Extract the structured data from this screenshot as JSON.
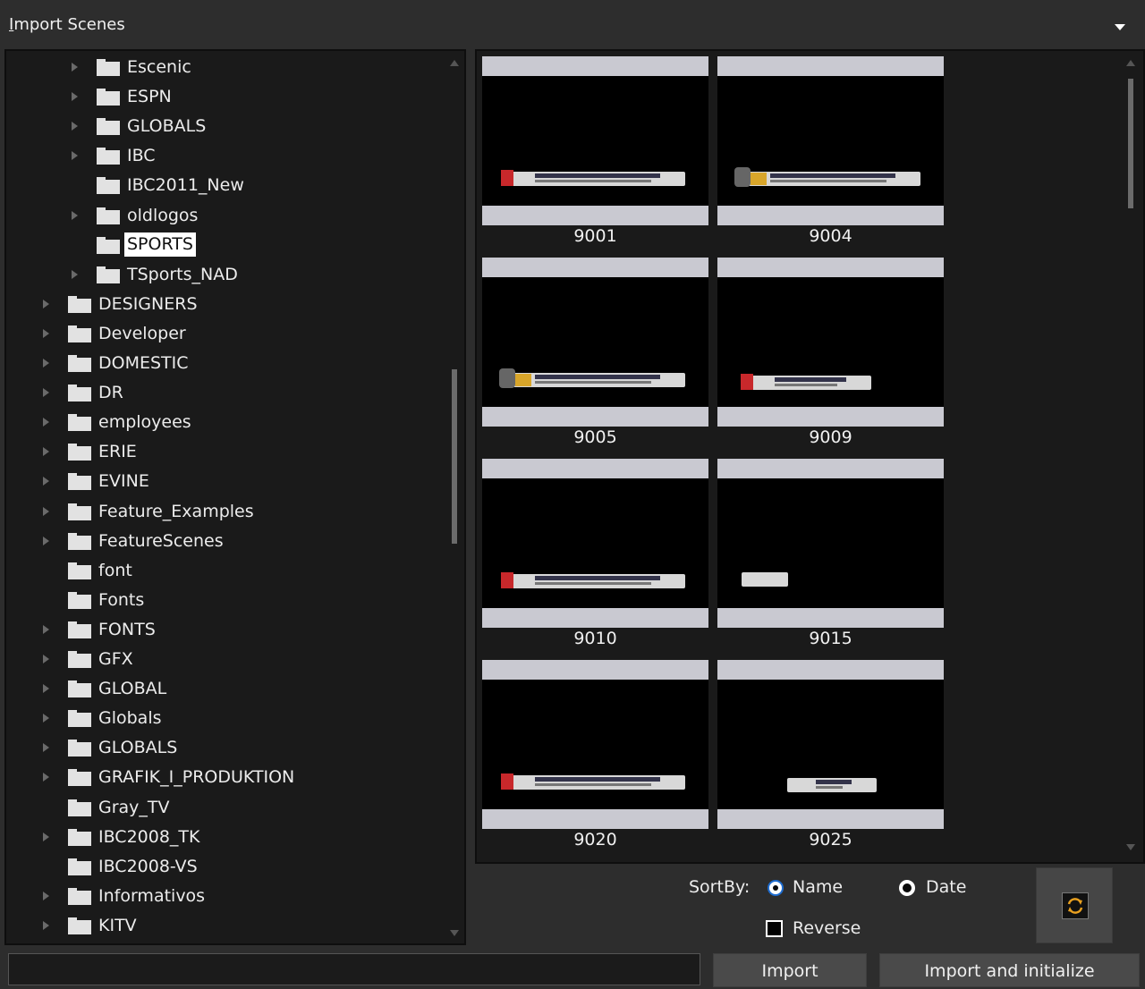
{
  "window": {
    "title": "Import Scenes",
    "title_mnemonic": "I",
    "title_rest": "mport Scenes"
  },
  "tree": {
    "items": [
      {
        "label": "Escenic",
        "level": 2,
        "expandable": true
      },
      {
        "label": "ESPN",
        "level": 2,
        "expandable": true
      },
      {
        "label": "GLOBALS",
        "level": 2,
        "expandable": true
      },
      {
        "label": "IBC",
        "level": 2,
        "expandable": true
      },
      {
        "label": "IBC2011_New",
        "level": 2,
        "expandable": false
      },
      {
        "label": "oldlogos",
        "level": 2,
        "expandable": true
      },
      {
        "label": "SPORTS",
        "level": 2,
        "expandable": false,
        "selected": true
      },
      {
        "label": "TSports_NAD",
        "level": 2,
        "expandable": true
      },
      {
        "label": "DESIGNERS",
        "level": 1,
        "expandable": true
      },
      {
        "label": "Developer",
        "level": 1,
        "expandable": true
      },
      {
        "label": "DOMESTIC",
        "level": 1,
        "expandable": true
      },
      {
        "label": "DR",
        "level": 1,
        "expandable": true
      },
      {
        "label": "employees",
        "level": 1,
        "expandable": true
      },
      {
        "label": "ERIE",
        "level": 1,
        "expandable": true
      },
      {
        "label": "EVINE",
        "level": 1,
        "expandable": true
      },
      {
        "label": "Feature_Examples",
        "level": 1,
        "expandable": true
      },
      {
        "label": "FeatureScenes",
        "level": 1,
        "expandable": true
      },
      {
        "label": "font",
        "level": 1,
        "expandable": false
      },
      {
        "label": "Fonts",
        "level": 1,
        "expandable": false
      },
      {
        "label": "FONTS",
        "level": 1,
        "expandable": true
      },
      {
        "label": "GFX",
        "level": 1,
        "expandable": true
      },
      {
        "label": "GLOBAL",
        "level": 1,
        "expandable": true
      },
      {
        "label": "Globals",
        "level": 1,
        "expandable": true
      },
      {
        "label": "GLOBALS",
        "level": 1,
        "expandable": true
      },
      {
        "label": "GRAFIK_I_PRODUKTION",
        "level": 1,
        "expandable": true
      },
      {
        "label": "Gray_TV",
        "level": 1,
        "expandable": false
      },
      {
        "label": "IBC2008_TK",
        "level": 1,
        "expandable": true
      },
      {
        "label": "IBC2008-VS",
        "level": 1,
        "expandable": false
      },
      {
        "label": "Informativos",
        "level": 1,
        "expandable": true
      },
      {
        "label": "KITV",
        "level": 1,
        "expandable": true
      }
    ]
  },
  "scenes": [
    {
      "name": "9001",
      "style": "red"
    },
    {
      "name": "9004",
      "style": "logo"
    },
    {
      "name": "9005",
      "style": "logo"
    },
    {
      "name": "9009",
      "style": "plain-red"
    },
    {
      "name": "9010",
      "style": "red"
    },
    {
      "name": "9015",
      "style": "small"
    },
    {
      "name": "9020",
      "style": "red"
    },
    {
      "name": "9025",
      "style": "plain"
    }
  ],
  "sort": {
    "label": "SortBy:",
    "options": [
      {
        "label": "Name",
        "selected": true
      },
      {
        "label": "Date",
        "selected": false
      }
    ],
    "reverse_label": "Reverse",
    "reverse_checked": false
  },
  "refresh": {
    "icon": "refresh-icon"
  },
  "footer": {
    "path_value": "",
    "import_label": "Import",
    "import_init_label": "Import and initialize"
  },
  "colors": {
    "accent": "#1e6ccf",
    "refresh_icon": "#e8a020"
  }
}
